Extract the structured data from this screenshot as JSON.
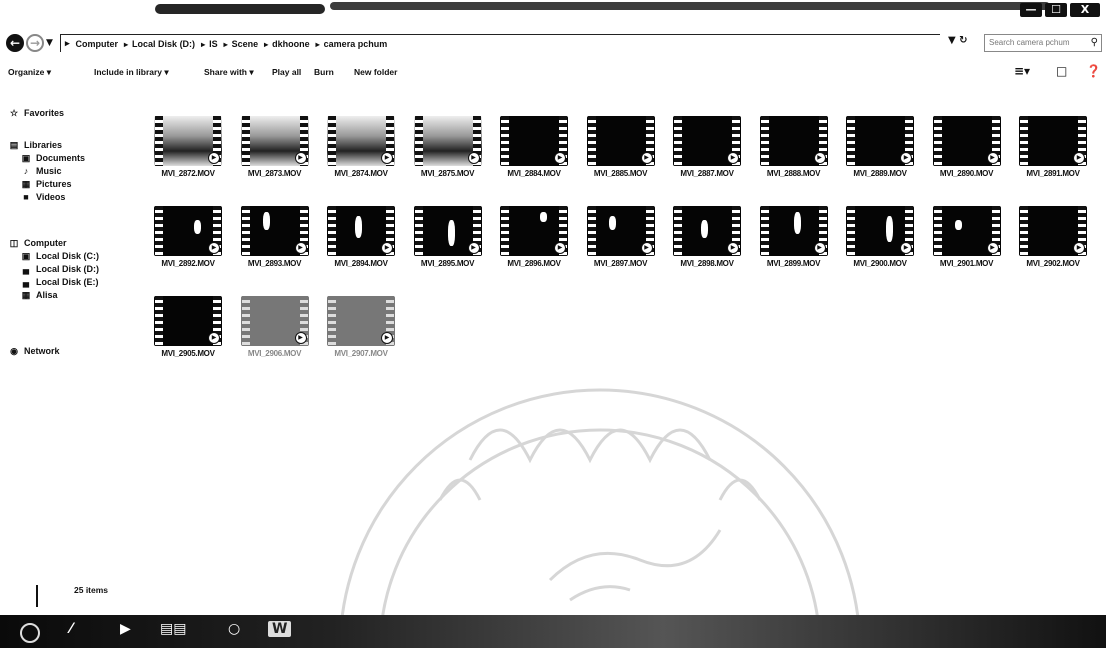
{
  "window": {
    "controls": {
      "minimize": "—",
      "maximize": "☐",
      "close": "X"
    }
  },
  "address": {
    "crumbs": [
      "Computer",
      "Local Disk (D:)",
      "IS",
      "Scene",
      "dkhoone",
      "camera pchum"
    ],
    "search_placeholder": "Search camera pchum"
  },
  "toolbar": {
    "organize": "Organize ▾",
    "include_in_library": "Include in library ▾",
    "share_with": "Share with ▾",
    "play_all": "Play all",
    "burn": "Burn",
    "new_folder": "New folder"
  },
  "nav": {
    "favorites": "Favorites",
    "libraries": "Libraries",
    "documents": "Documents",
    "music": "Music",
    "pictures": "Pictures",
    "videos": "Videos",
    "computer": "Computer",
    "local_c": "Local Disk (C:)",
    "local_d": "Local Disk (D:)",
    "local_e": "Local Disk (E:)",
    "alisa": "Alisa",
    "network": "Network"
  },
  "files": [
    {
      "name": "MVI_2872.MOV",
      "style": "scene"
    },
    {
      "name": "MVI_2873.MOV",
      "style": "scene"
    },
    {
      "name": "MVI_2874.MOV",
      "style": "scene"
    },
    {
      "name": "MVI_2875.MOV",
      "style": "scene"
    },
    {
      "name": "MVI_2884.MOV",
      "style": "dark"
    },
    {
      "name": "MVI_2885.MOV",
      "style": "dark"
    },
    {
      "name": "MVI_2887.MOV",
      "style": "dark"
    },
    {
      "name": "MVI_2888.MOV",
      "style": "dark"
    },
    {
      "name": "MVI_2889.MOV",
      "style": "dark"
    },
    {
      "name": "MVI_2890.MOV",
      "style": "dark"
    },
    {
      "name": "MVI_2891.MOV",
      "style": "dark"
    },
    {
      "name": "MVI_2892.MOV",
      "style": "dark"
    },
    {
      "name": "MVI_2893.MOV",
      "style": "dark"
    },
    {
      "name": "MVI_2894.MOV",
      "style": "dark"
    },
    {
      "name": "MVI_2895.MOV",
      "style": "dark"
    },
    {
      "name": "MVI_2896.MOV",
      "style": "dark"
    },
    {
      "name": "MVI_2897.MOV",
      "style": "dark"
    },
    {
      "name": "MVI_2898.MOV",
      "style": "dark"
    },
    {
      "name": "MVI_2899.MOV",
      "style": "dark"
    },
    {
      "name": "MVI_2900.MOV",
      "style": "dark"
    },
    {
      "name": "MVI_2901.MOV",
      "style": "dark"
    },
    {
      "name": "MVI_2902.MOV",
      "style": "dark"
    },
    {
      "name": "MVI_2905.MOV",
      "style": "dark"
    },
    {
      "name": "MVI_2906.MOV",
      "style": "gray"
    },
    {
      "name": "MVI_2907.MOV",
      "style": "gray"
    }
  ],
  "status": {
    "item_count": "25 items"
  },
  "taskbar": {
    "word_label": "W"
  }
}
